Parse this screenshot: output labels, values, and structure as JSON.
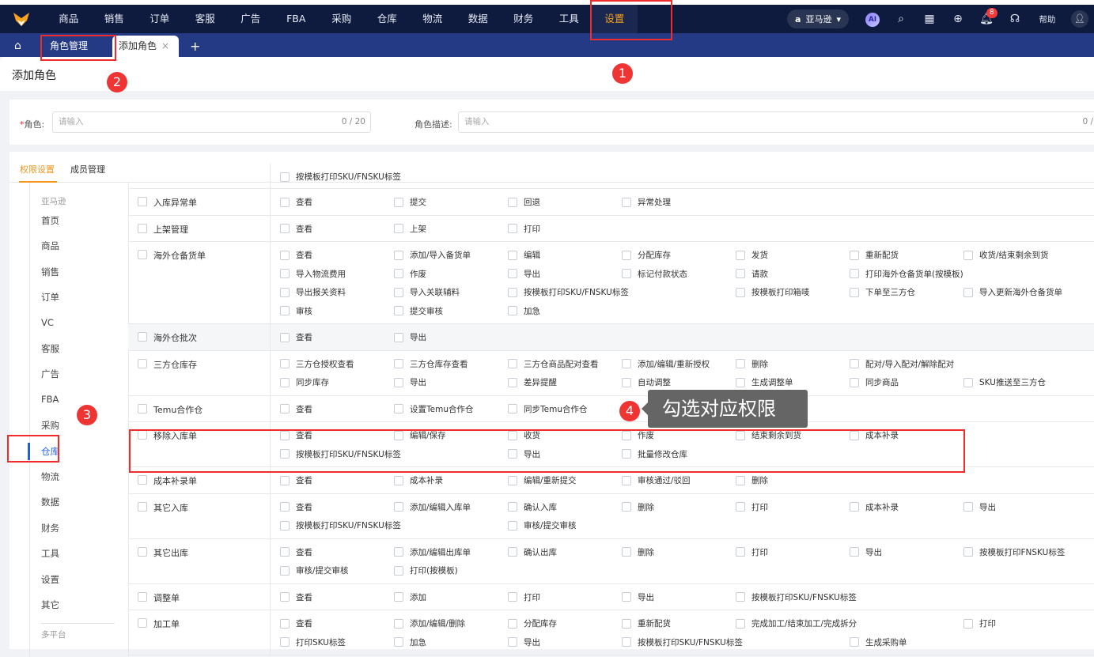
{
  "topnav": {
    "items": [
      "商品",
      "销售",
      "订单",
      "客服",
      "广告",
      "FBA",
      "采购",
      "仓库",
      "物流",
      "数据",
      "财务",
      "工具",
      "设置"
    ],
    "active": "设置"
  },
  "topright": {
    "marketplace": "亚马逊",
    "ai": "AI",
    "notification_count": "8",
    "help": "帮助"
  },
  "tabs": {
    "role_mgmt": "角色管理",
    "add_role": "添加角色",
    "close": "×",
    "add": "+"
  },
  "page_title": "添加角色",
  "form": {
    "role_label": "角色:",
    "required": "*",
    "role_placeholder": "请输入",
    "role_count": "0 / 20",
    "desc_label": "角色描述:",
    "desc_placeholder": "请输入",
    "desc_count": "0 /"
  },
  "content_tabs": [
    "权限设置",
    "成员管理"
  ],
  "sidebar": {
    "group1": "亚马逊",
    "items": [
      "首页",
      "商品",
      "销售",
      "订单",
      "VC",
      "客服",
      "广告",
      "FBA",
      "采购",
      "仓库",
      "物流",
      "数据",
      "财务",
      "工具",
      "设置",
      "其它"
    ],
    "active": "仓库",
    "group2": "多平台"
  },
  "rows": [
    {
      "name": "",
      "lines": [
        [
          "按模板打印SKU/FNSKU标签"
        ]
      ]
    },
    {
      "name": "入库异常单",
      "lines": [
        [
          "查看",
          "提交",
          "回退",
          "异常处理"
        ]
      ]
    },
    {
      "name": "上架管理",
      "lines": [
        [
          "查看",
          "上架",
          "打印"
        ]
      ]
    },
    {
      "name": "海外仓备货单",
      "lines": [
        [
          "查看",
          "添加/导入备货单",
          "编辑",
          "分配库存",
          "发货",
          "重新配货",
          "收货/结束剩余到货"
        ],
        [
          "导入物流费用",
          "作废",
          "导出",
          "标记付款状态",
          "请款",
          "打印海外仓备货单(按模板)"
        ],
        [
          "导出报关资料",
          "导入关联辅料",
          "按模板打印SKU/FNSKU标签",
          null,
          "按模板打印箱唛",
          "下单至三方仓",
          "导入更新海外仓备货单"
        ],
        [
          "审核",
          "提交审核",
          "加急"
        ]
      ]
    },
    {
      "name": "海外仓批次",
      "gray": true,
      "lines": [
        [
          "查看",
          "导出"
        ]
      ]
    },
    {
      "name": "三方仓库存",
      "lines": [
        [
          "三方仓授权查看",
          "三方仓库存查看",
          "三方仓商品配对查看",
          "添加/编辑/重新授权",
          "删除",
          "配对/导入配对/解除配对"
        ],
        [
          "同步库存",
          "导出",
          "差异提醒",
          "自动调整",
          "生成调整单",
          "同步商品",
          "SKU推送至三方仓"
        ]
      ]
    },
    {
      "name": "Temu合作仓",
      "lines": [
        [
          "查看",
          "设置Temu合作仓",
          "同步Temu合作仓"
        ]
      ]
    },
    {
      "name": "移除入库单",
      "lines": [
        [
          "查看",
          "编辑/保存",
          "收货",
          "作废",
          "结束剩余到货",
          "成本补录"
        ],
        [
          "按模板打印SKU/FNSKU标签",
          null,
          "导出",
          "批量修改仓库"
        ]
      ]
    },
    {
      "name": "成本补录单",
      "lines": [
        [
          "查看",
          "成本补录",
          "编辑/重新提交",
          "审核通过/驳回",
          "删除"
        ]
      ]
    },
    {
      "name": "其它入库",
      "lines": [
        [
          "查看",
          "添加/编辑入库单",
          "确认入库",
          "删除",
          "打印",
          "成本补录",
          "导出"
        ],
        [
          "按模板打印SKU/FNSKU标签",
          null,
          "审核/提交审核"
        ]
      ]
    },
    {
      "name": "其它出库",
      "lines": [
        [
          "查看",
          "添加/编辑出库单",
          "确认出库",
          "删除",
          "打印",
          "导出",
          "按模板打印FNSKU标签"
        ],
        [
          "审核/提交审核",
          "打印(按模板)"
        ]
      ]
    },
    {
      "name": "调整单",
      "lines": [
        [
          "查看",
          "添加",
          "打印",
          "导出",
          "按模板打印SKU/FNSKU标签"
        ]
      ]
    },
    {
      "name": "加工单",
      "lines": [
        [
          "查看",
          "添加/编辑/删除",
          "分配库存",
          "重新配货",
          "完成加工/结束加工/完成拆分",
          null,
          "打印"
        ],
        [
          "打印SKU标签",
          "加急",
          "导出",
          "按模板打印SKU/FNSKU标签",
          null,
          "生成采购单"
        ]
      ]
    }
  ],
  "annotations": {
    "n1": "1",
    "n2": "2",
    "n3": "3",
    "n4": "4",
    "tip": "勾选对应权限"
  }
}
